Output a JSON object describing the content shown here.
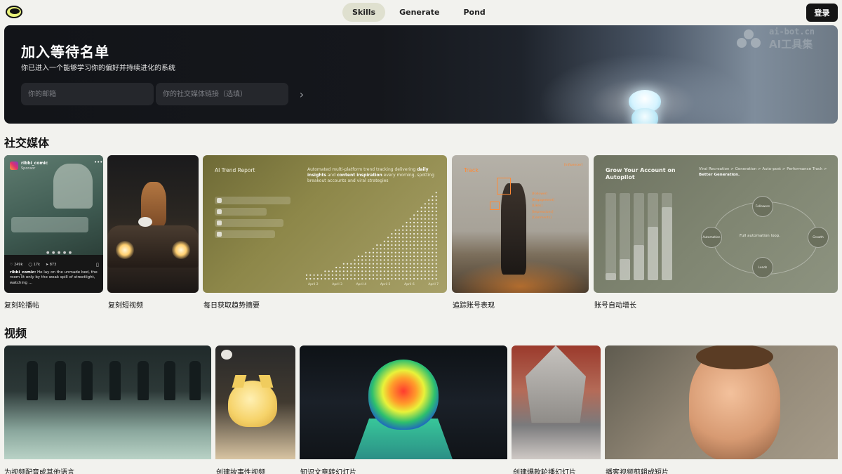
{
  "nav": {
    "tabs": [
      {
        "label": "Skills",
        "active": true
      },
      {
        "label": "Generate",
        "active": false
      },
      {
        "label": "Pond",
        "active": false
      }
    ],
    "login_label": "登录"
  },
  "banner": {
    "title": "加入等待名单",
    "subtitle": "你已进入一个能够学习你的偏好并持续进化的系统",
    "email_placeholder": "你的邮箱",
    "social_placeholder": "你的社交媒体链接（选填）",
    "submit_icon": "chevron-right-icon"
  },
  "watermark": {
    "line1": "ai-bot.cn",
    "line2": "AI工具集"
  },
  "social": {
    "section_title": "社交媒体",
    "cards": [
      {
        "label": "复刻轮播帖",
        "handle": "ribbi_comic",
        "handle_sub": "Sponsor",
        "likes": "♡ 249k",
        "comments": "◯ 17k",
        "shares": "➤ 873",
        "caption_user": "ribbi_comic:",
        "caption_text": "He lay on the unmade bed, the room lit only by the weak spill of streetlight, watching ..."
      },
      {
        "label": "复刻短视频"
      },
      {
        "label": "每日获取趋势摘要",
        "title": "AI Trend Report",
        "desc_pre": "Automated multi-platform trend tracking delivering ",
        "desc_b1": "daily insights",
        "desc_mid": " and ",
        "desc_b2": "content inspiration",
        "desc_post": " every morning, spotting breakout accounts and viral strategies",
        "ticks": [
          "April 2",
          "April 3",
          "April 4",
          "April 5",
          "April 6",
          "April 7"
        ]
      },
      {
        "label": "追踪账号表现",
        "title": "Track",
        "right_tag": "[Influencer]",
        "tags": [
          "[Follower]",
          "[Engagement]",
          "[Likes]",
          "[Impressions]",
          "[Comments]"
        ]
      },
      {
        "label": "账号自动增长",
        "title_line1": "Grow Your Account on",
        "title_line2": "Autopilot",
        "desc_pre": "Viral Recreation > Generation > Auto-post > Performance Track > ",
        "desc_b": "Better Generation.",
        "center": "Full automation loop.",
        "nodes": [
          "Followers",
          "Growth",
          "Leads",
          "Automation"
        ]
      }
    ]
  },
  "video": {
    "section_title": "视频",
    "cards": [
      {
        "label": "为视频配音成其他语言"
      },
      {
        "label": "创建故事性视频"
      },
      {
        "label": "知识文章转幻灯片"
      },
      {
        "label": "创建爆款轮播幻灯片"
      },
      {
        "label": "播客视频剪辑成短片"
      }
    ]
  },
  "colors": {
    "page_bg": "#f2f2ee",
    "active_tab_bg": "#dfe0cf",
    "login_bg": "#151515",
    "banner_bg": "#121418",
    "track_accent": "#ff8a36"
  }
}
